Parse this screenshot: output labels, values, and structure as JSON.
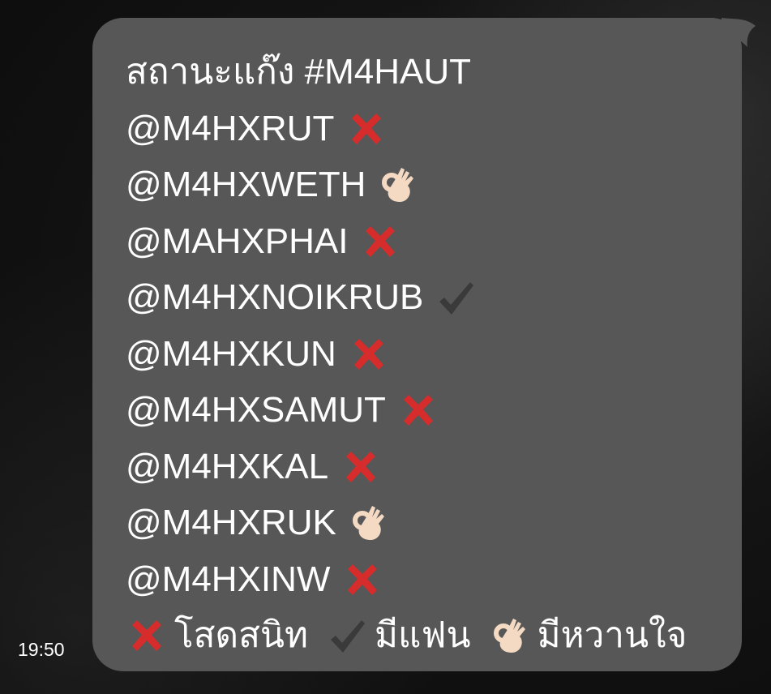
{
  "chat": {
    "title_line": "สถานะแก๊ง #M4HAUT",
    "members": [
      {
        "handle": "@M4HXRUT",
        "status_icon": "red-x-icon"
      },
      {
        "handle": "@M4HXWETH",
        "status_icon": "ok-hand-icon"
      },
      {
        "handle": "@MAHXPHAI",
        "status_icon": "red-x-icon"
      },
      {
        "handle": "@M4HXNOIKRUB",
        "status_icon": "check-mark-icon"
      },
      {
        "handle": "@M4HXKUN",
        "status_icon": "red-x-icon"
      },
      {
        "handle": "@M4HXSAMUT",
        "status_icon": "red-x-icon"
      },
      {
        "handle": "@M4HXKAL",
        "status_icon": "red-x-icon"
      },
      {
        "handle": "@M4HXRUK",
        "status_icon": "ok-hand-icon"
      },
      {
        "handle": "@M4HXINW",
        "status_icon": "red-x-icon"
      }
    ],
    "legend": [
      {
        "icon": "red-x-icon",
        "label": "โสดสนิท"
      },
      {
        "icon": "check-mark-icon",
        "label": "มีแฟน"
      },
      {
        "icon": "ok-hand-icon",
        "label": "มีหวานใจ"
      }
    ],
    "timestamp": "19:50",
    "colors": {
      "bubble": "#575757",
      "text": "#ffffff",
      "cross": "#d62c2c",
      "check": "#3a3a3a",
      "ok_hand": "#f4d9c3"
    }
  }
}
